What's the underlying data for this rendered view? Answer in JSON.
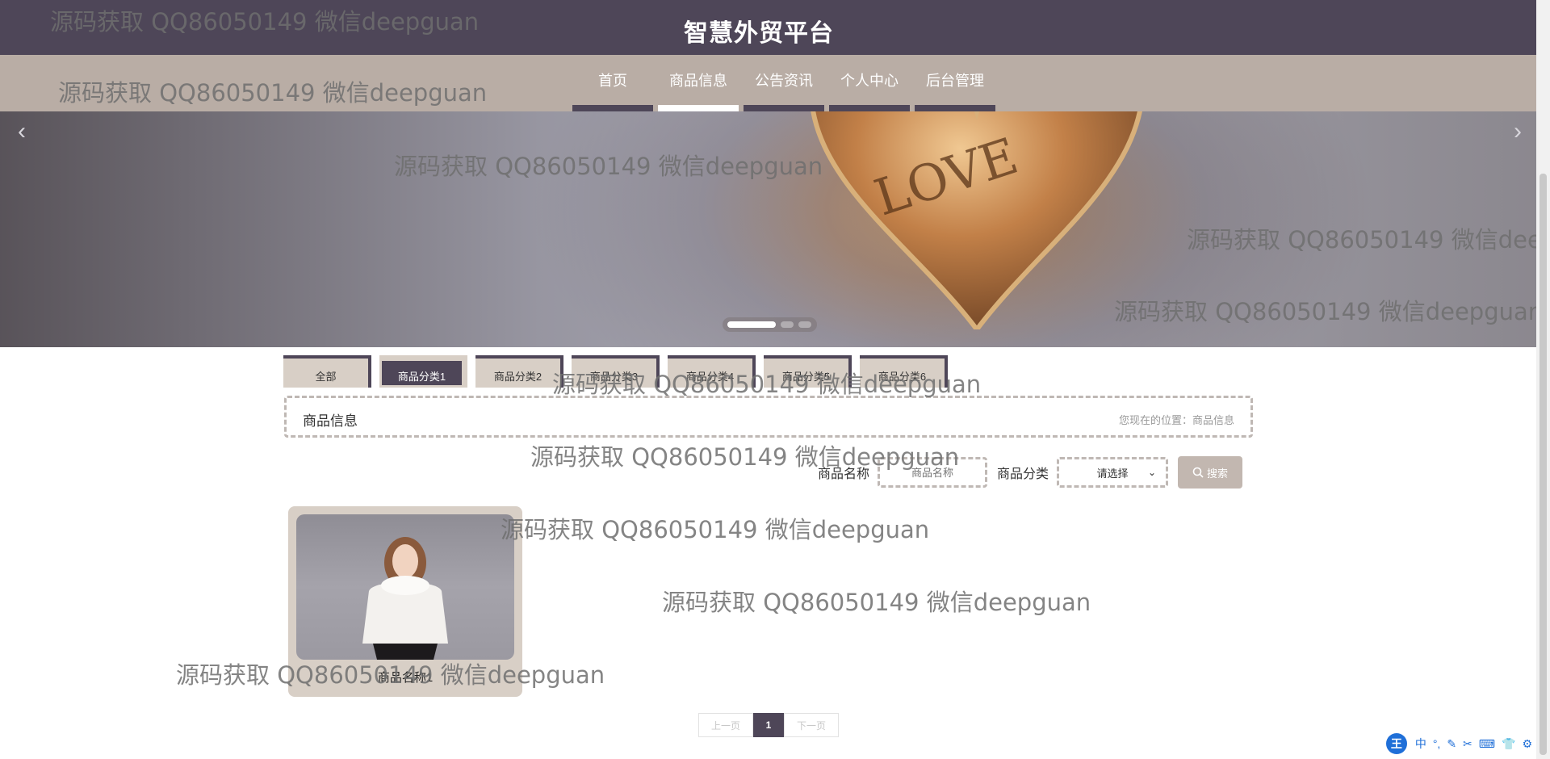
{
  "header": {
    "title": "智慧外贸平台"
  },
  "nav": [
    {
      "label": "首页",
      "active": false
    },
    {
      "label": "商品信息",
      "active": true
    },
    {
      "label": "公告资讯",
      "active": false
    },
    {
      "label": "个人中心",
      "active": false
    },
    {
      "label": "后台管理",
      "active": false
    }
  ],
  "banner": {
    "prev_glyph": "‹",
    "next_glyph": "›",
    "slide_count": 3,
    "active_slide": 1,
    "image_text": "LOVE"
  },
  "categories": [
    "全部",
    "商品分类1",
    "商品分类2",
    "商品分类3",
    "商品分类4",
    "商品分类5",
    "商品分类6"
  ],
  "active_category": "商品分类1",
  "section": {
    "title": "商品信息",
    "location": "您现在的位置：商品信息"
  },
  "search": {
    "name_label": "商品名称",
    "name_placeholder": "商品名称",
    "category_label": "商品分类",
    "category_selected": "请选择",
    "button_label": "搜索"
  },
  "products": [
    {
      "name": "商品名称1"
    }
  ],
  "pager": {
    "prev": "上一页",
    "current": "1",
    "next": "下一页"
  },
  "watermark": "源码获取 QQ86050149 微信deepguan",
  "ime": {
    "logo": "王",
    "items": [
      "中",
      "°,",
      "✎",
      "✂",
      "⌨",
      "👕",
      "⚙"
    ]
  },
  "colors": {
    "header": "#4e4658",
    "nav": "#b9ada5",
    "accent": "#4e4658",
    "card": "#d8cfc6"
  }
}
